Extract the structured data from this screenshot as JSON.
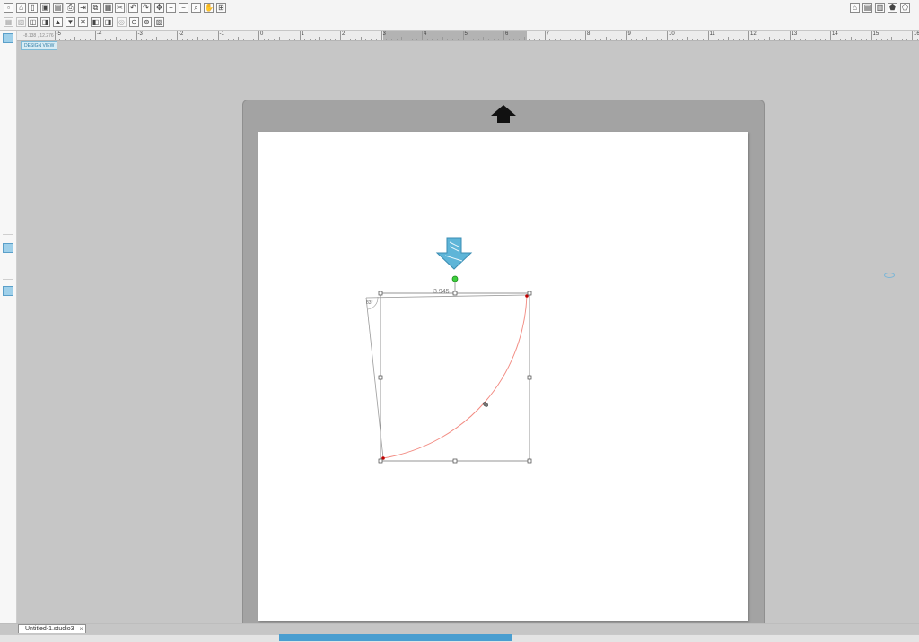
{
  "toolbar_top": {
    "icons": [
      "new-document-icon",
      "open-icon",
      "print-file-icon",
      "save-icon",
      "save-as-icon",
      "print-icon",
      "send-to-cutter-icon",
      "copy-icon",
      "paste-icon",
      "cut-icon",
      "undo-icon",
      "redo-icon",
      "pan-icon",
      "zoom-in-icon",
      "zoom-out-icon",
      "zoom-tool-icon",
      "hand-drag-icon",
      "fit-to-page-icon"
    ],
    "right_icons": [
      "send-icon",
      "design-page-icon",
      "library-icon",
      "store-icon",
      "shape-icon",
      "settings-icon"
    ]
  },
  "toolbar_second": {
    "icons": [
      "group-icon",
      "ungroup-icon",
      "compound-path-icon",
      "release-compound-icon",
      "bring-forward-icon",
      "send-backward-icon",
      "delete-icon",
      "duplicate-left-icon",
      "duplicate-right-icon",
      "offset-icon",
      "trace-icon",
      "weld-icon",
      "image-icon"
    ]
  },
  "left_tools": {
    "icons": [
      "select-icon",
      "edit-points-icon",
      "line-icon",
      "rectangle-icon",
      "rounded-rectangle-icon",
      "ellipse-icon",
      "polygon-icon",
      "curve-icon",
      "arc-icon",
      "freehand-icon",
      "smooth-freehand-icon",
      "arc-tool-icon",
      "regular-polygon-icon",
      "text-icon",
      "eraser-icon",
      "knife-icon",
      "cut-mode-icon",
      "sketch-mode-icon",
      "color-icon",
      "page-view-icon",
      "library-view-icon"
    ],
    "active": "select-icon"
  },
  "coords_readout": "-8.138 , 12.276",
  "design_view_label": "DESIGN VIEW",
  "ruler": {
    "labels": [
      "-5",
      "-4",
      "-3",
      "-2",
      "-1",
      "0",
      "1",
      "2",
      "3",
      "4",
      "5",
      "6",
      "7",
      "8",
      "9",
      "10",
      "11",
      "12",
      "13",
      "14",
      "15",
      "16"
    ]
  },
  "selection": {
    "width_label": "3.945",
    "angle_label": "83°"
  },
  "document_tab": {
    "label": "Untitled-1.studio3",
    "close": "x"
  },
  "colors": {
    "accent": "#4a9ed0",
    "curve": "#f28b82",
    "mat": "#a3a3a3",
    "canvas_bg": "#c6c6c6",
    "load_arrow": "#5eb5d8",
    "rotate_handle": "#3ccf3c"
  }
}
